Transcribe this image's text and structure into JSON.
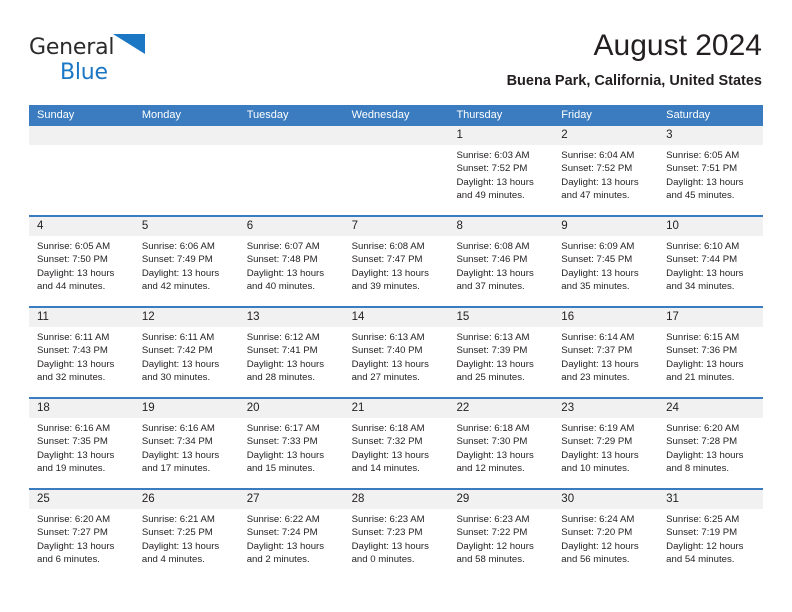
{
  "logo": {
    "word_one": "General",
    "word_two": "Blue",
    "triangle_icon": "triangle-icon",
    "brand_blue": "#1b77c4",
    "brand_dark": "#2b2b2b"
  },
  "header": {
    "title": "August 2024",
    "subtitle": "Buena Park, California, United States"
  },
  "colors": {
    "header_blue": "#3a7cbf",
    "daynum_band": "#f1f1f1",
    "text": "#231f20",
    "cell_background": "#ffffff"
  },
  "weekdays": [
    "Sunday",
    "Monday",
    "Tuesday",
    "Wednesday",
    "Thursday",
    "Friday",
    "Saturday"
  ],
  "weeks": [
    [
      {
        "day": "",
        "lines": []
      },
      {
        "day": "",
        "lines": []
      },
      {
        "day": "",
        "lines": []
      },
      {
        "day": "",
        "lines": []
      },
      {
        "day": "1",
        "lines": [
          "Sunrise: 6:03 AM",
          "Sunset: 7:52 PM",
          "Daylight: 13 hours",
          "and 49 minutes."
        ]
      },
      {
        "day": "2",
        "lines": [
          "Sunrise: 6:04 AM",
          "Sunset: 7:52 PM",
          "Daylight: 13 hours",
          "and 47 minutes."
        ]
      },
      {
        "day": "3",
        "lines": [
          "Sunrise: 6:05 AM",
          "Sunset: 7:51 PM",
          "Daylight: 13 hours",
          "and 45 minutes."
        ]
      }
    ],
    [
      {
        "day": "4",
        "lines": [
          "Sunrise: 6:05 AM",
          "Sunset: 7:50 PM",
          "Daylight: 13 hours",
          "and 44 minutes."
        ]
      },
      {
        "day": "5",
        "lines": [
          "Sunrise: 6:06 AM",
          "Sunset: 7:49 PM",
          "Daylight: 13 hours",
          "and 42 minutes."
        ]
      },
      {
        "day": "6",
        "lines": [
          "Sunrise: 6:07 AM",
          "Sunset: 7:48 PM",
          "Daylight: 13 hours",
          "and 40 minutes."
        ]
      },
      {
        "day": "7",
        "lines": [
          "Sunrise: 6:08 AM",
          "Sunset: 7:47 PM",
          "Daylight: 13 hours",
          "and 39 minutes."
        ]
      },
      {
        "day": "8",
        "lines": [
          "Sunrise: 6:08 AM",
          "Sunset: 7:46 PM",
          "Daylight: 13 hours",
          "and 37 minutes."
        ]
      },
      {
        "day": "9",
        "lines": [
          "Sunrise: 6:09 AM",
          "Sunset: 7:45 PM",
          "Daylight: 13 hours",
          "and 35 minutes."
        ]
      },
      {
        "day": "10",
        "lines": [
          "Sunrise: 6:10 AM",
          "Sunset: 7:44 PM",
          "Daylight: 13 hours",
          "and 34 minutes."
        ]
      }
    ],
    [
      {
        "day": "11",
        "lines": [
          "Sunrise: 6:11 AM",
          "Sunset: 7:43 PM",
          "Daylight: 13 hours",
          "and 32 minutes."
        ]
      },
      {
        "day": "12",
        "lines": [
          "Sunrise: 6:11 AM",
          "Sunset: 7:42 PM",
          "Daylight: 13 hours",
          "and 30 minutes."
        ]
      },
      {
        "day": "13",
        "lines": [
          "Sunrise: 6:12 AM",
          "Sunset: 7:41 PM",
          "Daylight: 13 hours",
          "and 28 minutes."
        ]
      },
      {
        "day": "14",
        "lines": [
          "Sunrise: 6:13 AM",
          "Sunset: 7:40 PM",
          "Daylight: 13 hours",
          "and 27 minutes."
        ]
      },
      {
        "day": "15",
        "lines": [
          "Sunrise: 6:13 AM",
          "Sunset: 7:39 PM",
          "Daylight: 13 hours",
          "and 25 minutes."
        ]
      },
      {
        "day": "16",
        "lines": [
          "Sunrise: 6:14 AM",
          "Sunset: 7:37 PM",
          "Daylight: 13 hours",
          "and 23 minutes."
        ]
      },
      {
        "day": "17",
        "lines": [
          "Sunrise: 6:15 AM",
          "Sunset: 7:36 PM",
          "Daylight: 13 hours",
          "and 21 minutes."
        ]
      }
    ],
    [
      {
        "day": "18",
        "lines": [
          "Sunrise: 6:16 AM",
          "Sunset: 7:35 PM",
          "Daylight: 13 hours",
          "and 19 minutes."
        ]
      },
      {
        "day": "19",
        "lines": [
          "Sunrise: 6:16 AM",
          "Sunset: 7:34 PM",
          "Daylight: 13 hours",
          "and 17 minutes."
        ]
      },
      {
        "day": "20",
        "lines": [
          "Sunrise: 6:17 AM",
          "Sunset: 7:33 PM",
          "Daylight: 13 hours",
          "and 15 minutes."
        ]
      },
      {
        "day": "21",
        "lines": [
          "Sunrise: 6:18 AM",
          "Sunset: 7:32 PM",
          "Daylight: 13 hours",
          "and 14 minutes."
        ]
      },
      {
        "day": "22",
        "lines": [
          "Sunrise: 6:18 AM",
          "Sunset: 7:30 PM",
          "Daylight: 13 hours",
          "and 12 minutes."
        ]
      },
      {
        "day": "23",
        "lines": [
          "Sunrise: 6:19 AM",
          "Sunset: 7:29 PM",
          "Daylight: 13 hours",
          "and 10 minutes."
        ]
      },
      {
        "day": "24",
        "lines": [
          "Sunrise: 6:20 AM",
          "Sunset: 7:28 PM",
          "Daylight: 13 hours",
          "and 8 minutes."
        ]
      }
    ],
    [
      {
        "day": "25",
        "lines": [
          "Sunrise: 6:20 AM",
          "Sunset: 7:27 PM",
          "Daylight: 13 hours",
          "and 6 minutes."
        ]
      },
      {
        "day": "26",
        "lines": [
          "Sunrise: 6:21 AM",
          "Sunset: 7:25 PM",
          "Daylight: 13 hours",
          "and 4 minutes."
        ]
      },
      {
        "day": "27",
        "lines": [
          "Sunrise: 6:22 AM",
          "Sunset: 7:24 PM",
          "Daylight: 13 hours",
          "and 2 minutes."
        ]
      },
      {
        "day": "28",
        "lines": [
          "Sunrise: 6:23 AM",
          "Sunset: 7:23 PM",
          "Daylight: 13 hours",
          "and 0 minutes."
        ]
      },
      {
        "day": "29",
        "lines": [
          "Sunrise: 6:23 AM",
          "Sunset: 7:22 PM",
          "Daylight: 12 hours",
          "and 58 minutes."
        ]
      },
      {
        "day": "30",
        "lines": [
          "Sunrise: 6:24 AM",
          "Sunset: 7:20 PM",
          "Daylight: 12 hours",
          "and 56 minutes."
        ]
      },
      {
        "day": "31",
        "lines": [
          "Sunrise: 6:25 AM",
          "Sunset: 7:19 PM",
          "Daylight: 12 hours",
          "and 54 minutes."
        ]
      }
    ]
  ]
}
